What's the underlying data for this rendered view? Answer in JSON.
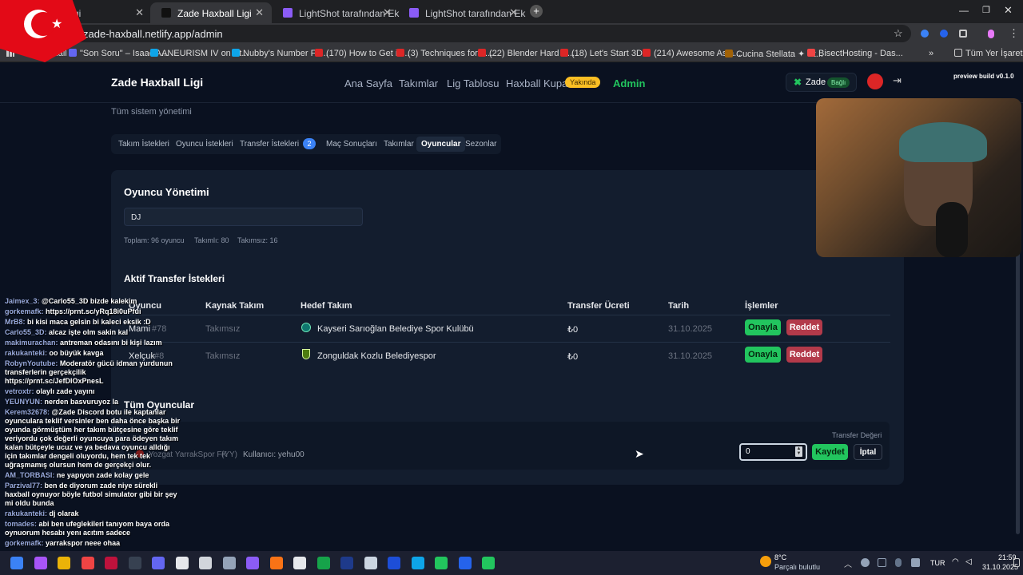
{
  "browser": {
    "tabs": [
      {
        "label": "li Ligi"
      },
      {
        "label": "Zade Haxball Ligi"
      },
      {
        "label": "LightShot tarafından Ekran Gör"
      },
      {
        "label": "LightShot tarafından Ekran Gör"
      }
    ],
    "url": "zade-haxball.netlify.app/admin",
    "bookmarks": [
      "Gmail",
      "\"Son Soru\" – Isaac A...",
      "ANEURISM IV on St...",
      "Nubby's Number Fa...",
      "(170) How to Get in...",
      "(3) Techniques for d...",
      "(22) Blender Hard S...",
      "(18) Let's Start 3D...",
      "(214) Awesome Asia...",
      "Cucina Stellata ✦ St...",
      "BisectHosting - Das..."
    ],
    "all_bookmarks": "Tüm Yer İşaretleri",
    "colors": {
      "accent": "#22c55e",
      "danger": "#b33a4a",
      "badge": "#3b82f6"
    }
  },
  "site": {
    "brand": "Zade Haxball Ligi",
    "nav": [
      "Ana Sayfa",
      "Takımlar",
      "Lig Tablosu",
      "Haxball Kupası",
      "Admin"
    ],
    "soon_badge": "Yakında",
    "user": "Zade",
    "user_status": "Bağlı",
    "build": "preview build v0.1.0"
  },
  "admin": {
    "subtitle": "Tüm sistem yönetimi",
    "tabs": [
      "Takım İstekleri",
      "Oyuncu İstekleri",
      "Transfer İstekleri",
      "Maç Sonuçları",
      "Takımlar",
      "Oyuncular",
      "Sezonlar"
    ],
    "transfer_count": "2",
    "player_mgmt": {
      "title": "Oyuncu Yönetimi",
      "search_value": "DJ",
      "stats": {
        "total": "Toplam: 96 oyuncu",
        "with_team": "Takımlı: 80",
        "without_team": "Takımsız: 16"
      }
    },
    "active_transfers": {
      "title": "Aktif Transfer İstekleri",
      "headers": [
        "Oyuncu",
        "Kaynak Takım",
        "Hedef Takım",
        "Transfer Ücreti",
        "Tarih",
        "İşlemler"
      ],
      "rows": [
        {
          "player": "Mami",
          "number": "#78",
          "source": "Takımsız",
          "target": "Kayseri Sarıoğlan Belediye Spor Kulübü",
          "fee": "₺0",
          "date": "31.10.2025"
        },
        {
          "player": "Xelçuk",
          "number": "#8",
          "source": "Takımsız",
          "target": "Zonguldak Kozlu Belediyespor",
          "fee": "₺0",
          "date": "31.10.2025"
        }
      ],
      "approve": "Onayla",
      "reject": "Reddet"
    },
    "all_players": {
      "title": "Tüm Oyuncular",
      "row": {
        "team": "Yozgat YarrakSpor FK",
        "tag": "(YY)",
        "user": "Kullanıcı: yehu00"
      },
      "transfer_value_label": "Transfer Değeri",
      "value": "0",
      "save": "Kaydet",
      "cancel": "İptal"
    }
  },
  "chat": [
    {
      "user": "Jaimex_3:",
      "msg": "@Carlo55_3D bizde kalekim"
    },
    {
      "user": "gorkemafk:",
      "msg": "https://prnt.sc/yRq18i0uPfui"
    },
    {
      "user": "MrB8:",
      "msg": "bi kisi maca gelsin bi kaleci eksik :D"
    },
    {
      "user": "Carlo55_3D:",
      "msg": "alcaz işte olm sakin kal"
    },
    {
      "user": "makimurachan:",
      "msg": "antreman odasını bi kişi lazım"
    },
    {
      "user": "rakukanteki:",
      "msg": "oo büyük kavga"
    },
    {
      "user": "RobynYoutube:",
      "msg": "Moderatör gücü idman yurdunun transferlerin gerçekçilik https://prnt.sc/JefDlOxPnesL"
    },
    {
      "user": "vetroxtr:",
      "msg": "olaylı zade yayını"
    },
    {
      "user": "YEUNYUN:",
      "msg": "nerden basvuruyoz la"
    },
    {
      "user": "Kerem32678:",
      "msg": "@Zade Discord botu ile kaptanlar oyunculara teklif versinler ben daha önce başka bir oyunda görmüştüm her takım bütçesine göre teklif veriyordu çok değerli oyuncuya para ödeyen takım kalan bütçeyle ucuz ve ya bedava oyuncu alldığı için takımlar dengeli oluyordu, hem tek tek uğraşmamış olursun hem de gerçekçi olur."
    },
    {
      "user": "AM_TORBASI:",
      "msg": "ne yapıyon zade kolay gele"
    },
    {
      "user": "Parzival77:",
      "msg": "ben de diyorum zade niye sürekli haxball oynuyor böyle futbol simulator gibi bir şey mi oldu bunda"
    },
    {
      "user": "rakukanteki:",
      "msg": "dj olarak"
    },
    {
      "user": "tomades:",
      "msg": "abi ben ufeglekileri tanıyom baya orda oynuorum hesabı yenı acıtım sadece"
    },
    {
      "user": "gorkemafk:",
      "msg": "yarrakspor neee ohaa"
    }
  ],
  "taskbar": {
    "weather_temp": "8°C",
    "weather_desc": "Parçalı bulutlu",
    "lang": "TUR",
    "time": "21:59",
    "date": "31.10.2025",
    "icons": [
      "windows-icon",
      "copilot-icon",
      "explorer-icon",
      "chrome-icon",
      "opera-icon",
      "obs-icon",
      "discord-icon",
      "github-icon",
      "unreal-icon",
      "unity-icon",
      "vs-icon",
      "blender-icon",
      "notepad-icon",
      "pt-icon",
      "fr-icon",
      "inkscape-icon",
      "ps-icon",
      "steam-icon",
      "spotify-icon",
      "trello-icon",
      "gamepad-icon"
    ]
  }
}
